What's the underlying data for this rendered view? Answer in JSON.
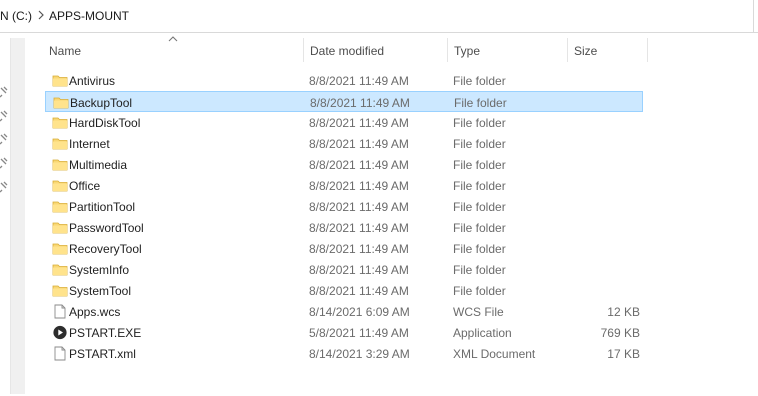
{
  "breadcrumb": {
    "drive": "N (C:)",
    "separator_icon": "chevron-right-icon",
    "folder": "APPS-MOUNT"
  },
  "columns": {
    "name": "Name",
    "date": "Date modified",
    "type": "Type",
    "size": "Size",
    "sort_icon": "chevron-up-icon"
  },
  "colors": {
    "selection_bg": "#cce8ff",
    "selection_border": "#99d1ff",
    "folder_yellow": "#f8d775"
  },
  "files": [
    {
      "name": "Antivirus",
      "date": "8/8/2021 11:49 AM",
      "type": "File folder",
      "size": "",
      "icon": "folder-icon"
    },
    {
      "name": "BackupTool",
      "date": "8/8/2021 11:49 AM",
      "type": "File folder",
      "size": "",
      "icon": "folder-icon",
      "selected": true
    },
    {
      "name": "HardDiskTool",
      "date": "8/8/2021 11:49 AM",
      "type": "File folder",
      "size": "",
      "icon": "folder-icon"
    },
    {
      "name": "Internet",
      "date": "8/8/2021 11:49 AM",
      "type": "File folder",
      "size": "",
      "icon": "folder-icon"
    },
    {
      "name": "Multimedia",
      "date": "8/8/2021 11:49 AM",
      "type": "File folder",
      "size": "",
      "icon": "folder-icon"
    },
    {
      "name": "Office",
      "date": "8/8/2021 11:49 AM",
      "type": "File folder",
      "size": "",
      "icon": "folder-icon"
    },
    {
      "name": "PartitionTool",
      "date": "8/8/2021 11:49 AM",
      "type": "File folder",
      "size": "",
      "icon": "folder-icon"
    },
    {
      "name": "PasswordTool",
      "date": "8/8/2021 11:49 AM",
      "type": "File folder",
      "size": "",
      "icon": "folder-icon"
    },
    {
      "name": "RecoveryTool",
      "date": "8/8/2021 11:49 AM",
      "type": "File folder",
      "size": "",
      "icon": "folder-icon"
    },
    {
      "name": "SystemInfo",
      "date": "8/8/2021 11:49 AM",
      "type": "File folder",
      "size": "",
      "icon": "folder-icon"
    },
    {
      "name": "SystemTool",
      "date": "8/8/2021 11:49 AM",
      "type": "File folder",
      "size": "",
      "icon": "folder-icon"
    },
    {
      "name": "Apps.wcs",
      "date": "8/14/2021 6:09 AM",
      "type": "WCS File",
      "size": "12 KB",
      "icon": "document-icon"
    },
    {
      "name": "PSTART.EXE",
      "date": "5/8/2021 11:49 AM",
      "type": "Application",
      "size": "769 KB",
      "icon": "play-circle-icon"
    },
    {
      "name": "PSTART.xml",
      "date": "8/14/2021 3:29 AM",
      "type": "XML Document",
      "size": "17 KB",
      "icon": "document-icon"
    }
  ]
}
